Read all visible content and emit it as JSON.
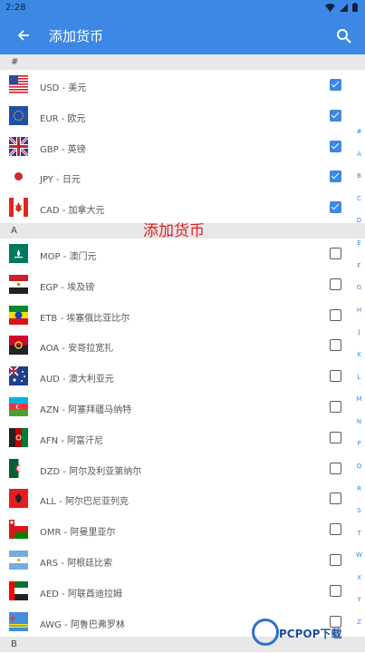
{
  "status": {
    "time": "2:28"
  },
  "header": {
    "title": "添加货币"
  },
  "overlay": {
    "title": "添加货币"
  },
  "sections": [
    {
      "letter": "#",
      "items": [
        {
          "label": "USD - 美元",
          "flag": "us",
          "checked": true
        },
        {
          "label": "EUR - 欧元",
          "flag": "eu",
          "checked": true
        },
        {
          "label": "GBP - 英镑",
          "flag": "gb",
          "checked": true
        },
        {
          "label": "JPY - 日元",
          "flag": "jp",
          "checked": true
        },
        {
          "label": "CAD - 加拿大元",
          "flag": "ca",
          "checked": true
        }
      ]
    },
    {
      "letter": "A",
      "items": [
        {
          "label": "MOP - 澳门元",
          "flag": "mo",
          "checked": false
        },
        {
          "label": "EGP - 埃及镑",
          "flag": "eg",
          "checked": false
        },
        {
          "label": "ETB - 埃塞俄比亚比尔",
          "flag": "et",
          "checked": false
        },
        {
          "label": "AOA - 安哥拉宽扎",
          "flag": "ao",
          "checked": false
        },
        {
          "label": "AUD - 澳大利亚元",
          "flag": "au",
          "checked": false
        },
        {
          "label": "AZN - 阿塞拜疆马纳特",
          "flag": "az",
          "checked": false
        },
        {
          "label": "AFN - 阿富汗尼",
          "flag": "af",
          "checked": false
        },
        {
          "label": "DZD - 阿尔及利亚第纳尔",
          "flag": "dz",
          "checked": false
        },
        {
          "label": "ALL - 阿尔巴尼亚列克",
          "flag": "al",
          "checked": false
        },
        {
          "label": "OMR - 阿曼里亚尔",
          "flag": "om",
          "checked": false
        },
        {
          "label": "ARS - 阿根廷比索",
          "flag": "ar",
          "checked": false
        },
        {
          "label": "AED - 阿联酋迪拉姆",
          "flag": "ae",
          "checked": false
        },
        {
          "label": "AWG - 阿鲁巴弗罗林",
          "flag": "aw",
          "checked": false
        }
      ]
    },
    {
      "letter": "B",
      "items": []
    }
  ],
  "index_letters": [
    "#",
    "A",
    "B",
    "C",
    "D",
    "E",
    "F",
    "G",
    "H",
    "J",
    "K",
    "L",
    "M",
    "N",
    "P",
    "Q",
    "R",
    "S",
    "T",
    "W",
    "X",
    "Y",
    "Z"
  ],
  "watermark": {
    "text": "PCPOP下载"
  },
  "colors": {
    "primary": "#3c88e4",
    "overlay": "#e02020"
  }
}
